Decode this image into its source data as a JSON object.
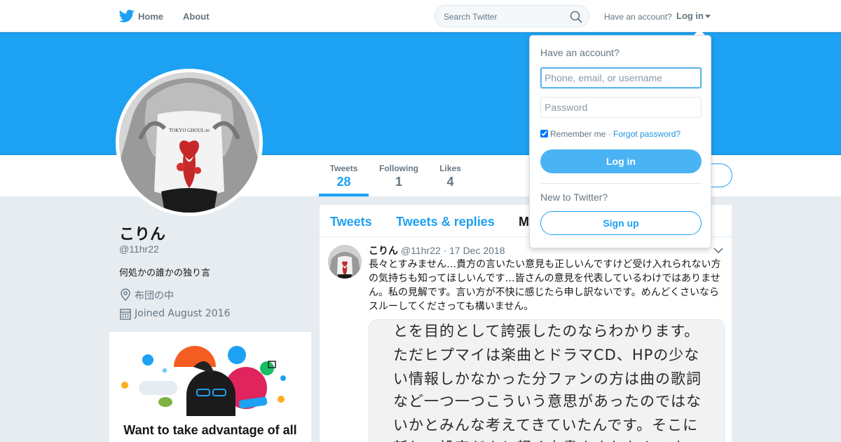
{
  "nav": {
    "home_label": "Home",
    "about_label": "About",
    "search_placeholder": "Search Twitter",
    "have_account": "Have an account?",
    "login_label": "Log in"
  },
  "colors": {
    "brand_blue": "#1da1f2",
    "banner": "#1da1f2",
    "background": "#e6ecf0"
  },
  "icons": {
    "logo": "twitter-bird-icon",
    "search": "search-icon",
    "location": "location-pin-icon",
    "calendar": "calendar-icon",
    "caret": "chevron-down-icon"
  },
  "profile": {
    "name": "こりん",
    "handle": "@11hr22",
    "bio": "何処かの誰かの独り言",
    "location": "布団の中",
    "joined": "Joined August 2016",
    "stats": [
      {
        "label": "Tweets",
        "value": "28"
      },
      {
        "label": "Following",
        "value": "1"
      },
      {
        "label": "Likes",
        "value": "4"
      }
    ]
  },
  "promo": {
    "title": "Want to take advantage of all"
  },
  "timeline": {
    "tabs": [
      "Tweets",
      "Tweets & replies",
      "Media"
    ],
    "tweet": {
      "name": "こりん",
      "handle": "@11hr22",
      "separator": "·",
      "date": "17 Dec 2018",
      "text": "長々とすみません…貴方の言いたい意見も正しいんですけど受け入れられない方の気持ちも知ってほしいんです…皆さんの意見を代表しているわけではありません。私の見解です。言い方が不快に感じたら申し訳ないです。めんどくさいならスルーしてくださっても構いません。",
      "media_lines": [
        "とを目的として誇張したのならわかります。",
        "ただヒプマイは楽曲とドラマCD、HPの少な",
        "い情報しかなかった分ファンの方は曲の歌詞",
        "など一つ一つこういう意思があったのではな",
        "いかとみんな考えてきていたんです。そこに",
        "新しい設定だよと軽く上書きされたんです"
      ]
    }
  },
  "login_dropdown": {
    "title": "Have an account?",
    "username_placeholder": "Phone, email, or username",
    "password_placeholder": "Password",
    "remember_label": "Remember me",
    "separator": "·",
    "forgot_label": "Forgot password?",
    "login_button": "Log in",
    "new_label": "New to Twitter?",
    "signup_button": "Sign up"
  }
}
